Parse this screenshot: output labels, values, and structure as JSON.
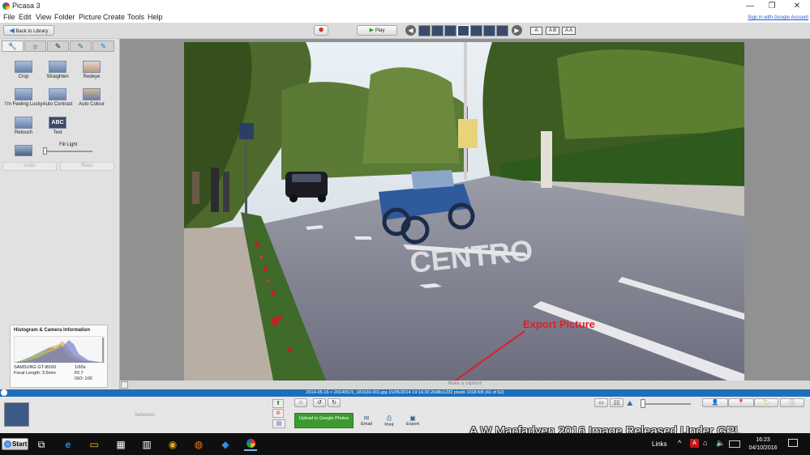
{
  "window": {
    "title": "Picasa 3",
    "minimize_glyph": "—",
    "maximize_glyph": "❐",
    "close_glyph": "✕"
  },
  "menu": {
    "items": [
      "File",
      "Edit",
      "View",
      "Folder",
      "Picture",
      "Create",
      "Tools",
      "Help"
    ],
    "signin": "Sign in with Google Account"
  },
  "toolbar": {
    "back": "Back to Library",
    "play": "Play",
    "caption_buttons": [
      "A",
      "A B",
      "A A"
    ]
  },
  "tools": {
    "tabs": [
      "wrench-icon",
      "sun-icon",
      "brush-icon",
      "effects-icon",
      "effects2-icon"
    ],
    "row1": [
      "Crop",
      "Straighten",
      "Redeye"
    ],
    "row2": [
      "I'm Feeling Lucky",
      "Auto Contrast",
      "Auto Colour"
    ],
    "row3": [
      "Retouch",
      "Text"
    ],
    "text_icon_label": "ABC",
    "fill_light": "Fill Light",
    "undo": "Undo",
    "redo": "Redo"
  },
  "histogram": {
    "title": "Histogram & Camera Information",
    "camera": "SAMSUNG GT-I8160",
    "focal": "Focal Length: 3.5mm",
    "shutter": "1/60s",
    "aperture": "f/2.7",
    "iso": "ISO: 100"
  },
  "photo": {
    "annotation": "Export Picture",
    "road_text": "CENTRO"
  },
  "caption_bar": {
    "text": "Make a caption!"
  },
  "info_bar": {
    "text": "2014-05-15 > 20140515_181630-001.jpg   15/05/2014 19:16:30   2048x1232 pixels   1018 KB   (41 of 62)"
  },
  "bottom": {
    "selection_label": "Selection",
    "upload": "Upload to Google Photos",
    "actions": [
      "Email",
      "Print",
      "Export"
    ]
  },
  "taskbar": {
    "start": "Start",
    "links": "Links",
    "time": "16:23",
    "date": "04/10/2016"
  },
  "watermark": "A W Macfadyen 2016  Image Released Under GPL",
  "colors": {
    "accent": "#1d6fb8",
    "annotation": "#e01e2a",
    "upload": "#3c9b2f"
  }
}
